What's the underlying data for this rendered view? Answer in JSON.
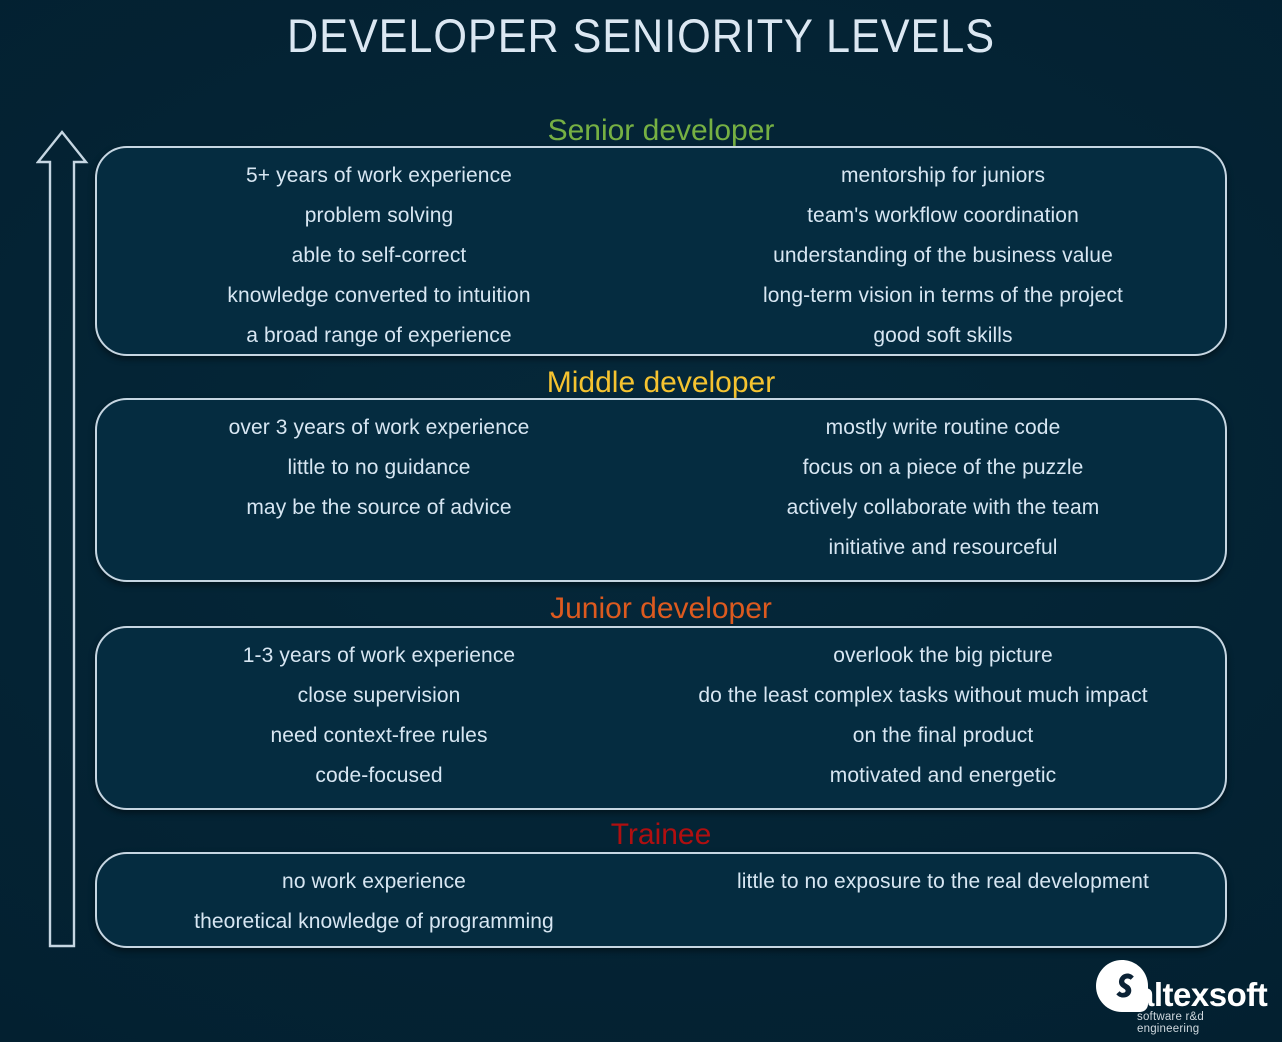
{
  "title": "DEVELOPER SENIORITY LEVELS",
  "colors": {
    "background": "#032030",
    "box_fill": "#052c40",
    "box_border": "#c6d6e2",
    "text": "#d7e6f2",
    "senior": "#76b043",
    "middle": "#f5c330",
    "junior": "#dd5a1f",
    "trainee": "#b00f10",
    "arrow": "#c6d6e2"
  },
  "arrow": {
    "name": "upward-progression-arrow",
    "direction": "up"
  },
  "tiers": [
    {
      "id": "senior",
      "label": "Senior developer",
      "color": "#76b043",
      "left_items": [
        "5+ years of work experience",
        "problem solving",
        "able to self-correct",
        "knowledge converted to intuition",
        "a broad range of experience"
      ],
      "right_items": [
        "mentorship for juniors",
        "team's workflow coordination",
        "understanding of the business value",
        "long-term vision in terms of the project",
        "good soft skills"
      ]
    },
    {
      "id": "middle",
      "label": "Middle developer",
      "color": "#f5c330",
      "left_items": [
        "over 3 years of work experience",
        "little to no guidance",
        "may be the source of advice",
        ""
      ],
      "right_items": [
        "mostly write routine code",
        "focus on a piece of the puzzle",
        "actively collaborate with the team",
        "initiative and resourceful"
      ]
    },
    {
      "id": "junior",
      "label": "Junior developer",
      "color": "#dd5a1f",
      "left_items": [
        "1-3 years of work experience",
        "close supervision",
        "need context-free rules",
        "code-focused"
      ],
      "right_items": [
        "overlook the big picture",
        "do the least complex tasks  without much impact",
        "on the final product",
        "motivated and energetic"
      ]
    },
    {
      "id": "trainee",
      "label": "Trainee",
      "color": "#b00f10",
      "left_items": [
        "no work experience",
        "theoretical knowledge of programming"
      ],
      "right_items": [
        "little to no exposure  to the real development",
        ""
      ]
    }
  ],
  "logo": {
    "mark": "altexsoft-speech-bubble-mark",
    "word": "altexsoft",
    "tagline": "software r&d engineering"
  }
}
